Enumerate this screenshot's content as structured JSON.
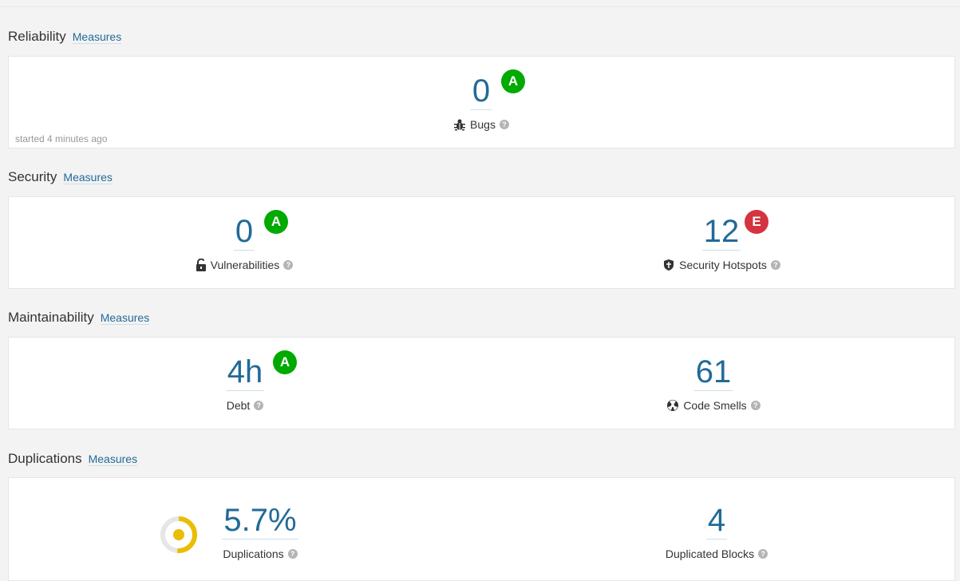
{
  "sections": {
    "reliability": {
      "title": "Reliability",
      "measures_link": "Measures",
      "started": "started 4 minutes ago"
    },
    "security": {
      "title": "Security",
      "measures_link": "Measures"
    },
    "maintainability": {
      "title": "Maintainability",
      "measures_link": "Measures"
    },
    "duplications": {
      "title": "Duplications",
      "measures_link": "Measures"
    }
  },
  "metrics": {
    "bugs": {
      "value": "0",
      "rating": "A",
      "label": "Bugs",
      "icon": "bug-icon"
    },
    "vulnerabilities": {
      "value": "0",
      "rating": "A",
      "label": "Vulnerabilities",
      "icon": "lock-icon"
    },
    "hotspots": {
      "value": "12",
      "rating": "E",
      "label": "Security Hotspots",
      "icon": "shield-icon"
    },
    "debt": {
      "value": "4h",
      "rating": "A",
      "label": "Debt"
    },
    "code_smells": {
      "value": "61",
      "label": "Code Smells",
      "icon": "smell-icon"
    },
    "duplications": {
      "value": "5.7%",
      "label": "Duplications",
      "donut_fraction": 0.057
    },
    "duplicated_blocks": {
      "value": "4",
      "label": "Duplicated Blocks"
    }
  },
  "colors": {
    "rating_a": "#00aa00",
    "rating_e": "#d4333f",
    "link": "#236a97",
    "duplication_donut": "#eabe06"
  },
  "help_glyph": "?"
}
